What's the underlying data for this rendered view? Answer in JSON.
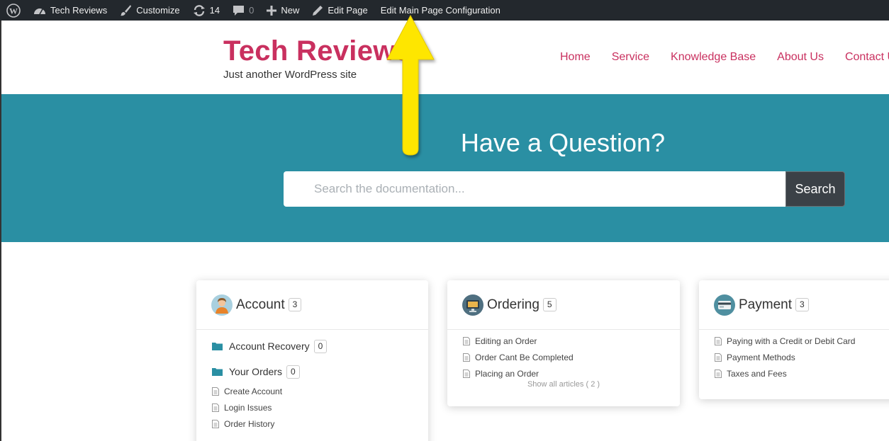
{
  "admin_bar": {
    "site_name": "Tech Reviews",
    "customize": "Customize",
    "updates_count": "14",
    "comments_count": "0",
    "new_label": "New",
    "edit_page": "Edit Page",
    "edit_main_config": "Edit Main Page Configuration"
  },
  "site": {
    "title": "Tech Reviews",
    "description": "Just another WordPress site"
  },
  "nav": {
    "items": [
      "Home",
      "Service",
      "Knowledge Base",
      "About Us",
      "Contact U"
    ]
  },
  "hero": {
    "title": "Have a Question?",
    "search_placeholder": "Search the documentation...",
    "search_button": "Search"
  },
  "categories": [
    {
      "title": "Account",
      "count": "3",
      "icon": "user-avatar-icon",
      "subfolders": [
        {
          "label": "Account Recovery",
          "count": "0"
        },
        {
          "label": "Your Orders",
          "count": "0"
        }
      ],
      "articles": [
        "Create Account",
        "Login Issues",
        "Order History"
      ]
    },
    {
      "title": "Ordering",
      "count": "5",
      "icon": "monitor-icon",
      "articles": [
        "Editing an Order",
        "Order Cant Be Completed",
        "Placing an Order"
      ],
      "show_all": "Show all articles ( 2 )"
    },
    {
      "title": "Payment",
      "count": "3",
      "icon": "credit-card-icon",
      "articles": [
        "Paying with a Credit or Debit Card",
        "Payment Methods",
        "Taxes and Fees"
      ]
    }
  ],
  "colors": {
    "admin_bar_bg": "#23282d",
    "brand": "#c9305f",
    "hero_bg": "#2a8fa3",
    "search_button_bg": "#3b4147",
    "annotation_arrow": "#fee600"
  }
}
